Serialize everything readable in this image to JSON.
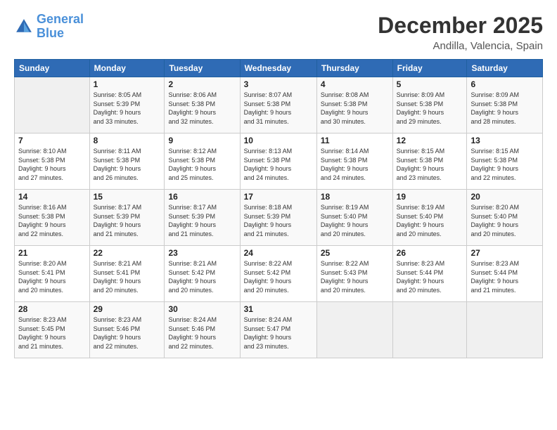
{
  "header": {
    "logo_line1": "General",
    "logo_line2": "Blue",
    "month": "December 2025",
    "location": "Andilla, Valencia, Spain"
  },
  "weekdays": [
    "Sunday",
    "Monday",
    "Tuesday",
    "Wednesday",
    "Thursday",
    "Friday",
    "Saturday"
  ],
  "weeks": [
    [
      {
        "day": "",
        "info": ""
      },
      {
        "day": "1",
        "info": "Sunrise: 8:05 AM\nSunset: 5:39 PM\nDaylight: 9 hours\nand 33 minutes."
      },
      {
        "day": "2",
        "info": "Sunrise: 8:06 AM\nSunset: 5:38 PM\nDaylight: 9 hours\nand 32 minutes."
      },
      {
        "day": "3",
        "info": "Sunrise: 8:07 AM\nSunset: 5:38 PM\nDaylight: 9 hours\nand 31 minutes."
      },
      {
        "day": "4",
        "info": "Sunrise: 8:08 AM\nSunset: 5:38 PM\nDaylight: 9 hours\nand 30 minutes."
      },
      {
        "day": "5",
        "info": "Sunrise: 8:09 AM\nSunset: 5:38 PM\nDaylight: 9 hours\nand 29 minutes."
      },
      {
        "day": "6",
        "info": "Sunrise: 8:09 AM\nSunset: 5:38 PM\nDaylight: 9 hours\nand 28 minutes."
      }
    ],
    [
      {
        "day": "7",
        "info": "Sunrise: 8:10 AM\nSunset: 5:38 PM\nDaylight: 9 hours\nand 27 minutes."
      },
      {
        "day": "8",
        "info": "Sunrise: 8:11 AM\nSunset: 5:38 PM\nDaylight: 9 hours\nand 26 minutes."
      },
      {
        "day": "9",
        "info": "Sunrise: 8:12 AM\nSunset: 5:38 PM\nDaylight: 9 hours\nand 25 minutes."
      },
      {
        "day": "10",
        "info": "Sunrise: 8:13 AM\nSunset: 5:38 PM\nDaylight: 9 hours\nand 24 minutes."
      },
      {
        "day": "11",
        "info": "Sunrise: 8:14 AM\nSunset: 5:38 PM\nDaylight: 9 hours\nand 24 minutes."
      },
      {
        "day": "12",
        "info": "Sunrise: 8:15 AM\nSunset: 5:38 PM\nDaylight: 9 hours\nand 23 minutes."
      },
      {
        "day": "13",
        "info": "Sunrise: 8:15 AM\nSunset: 5:38 PM\nDaylight: 9 hours\nand 22 minutes."
      }
    ],
    [
      {
        "day": "14",
        "info": "Sunrise: 8:16 AM\nSunset: 5:38 PM\nDaylight: 9 hours\nand 22 minutes."
      },
      {
        "day": "15",
        "info": "Sunrise: 8:17 AM\nSunset: 5:39 PM\nDaylight: 9 hours\nand 21 minutes."
      },
      {
        "day": "16",
        "info": "Sunrise: 8:17 AM\nSunset: 5:39 PM\nDaylight: 9 hours\nand 21 minutes."
      },
      {
        "day": "17",
        "info": "Sunrise: 8:18 AM\nSunset: 5:39 PM\nDaylight: 9 hours\nand 21 minutes."
      },
      {
        "day": "18",
        "info": "Sunrise: 8:19 AM\nSunset: 5:40 PM\nDaylight: 9 hours\nand 20 minutes."
      },
      {
        "day": "19",
        "info": "Sunrise: 8:19 AM\nSunset: 5:40 PM\nDaylight: 9 hours\nand 20 minutes."
      },
      {
        "day": "20",
        "info": "Sunrise: 8:20 AM\nSunset: 5:40 PM\nDaylight: 9 hours\nand 20 minutes."
      }
    ],
    [
      {
        "day": "21",
        "info": "Sunrise: 8:20 AM\nSunset: 5:41 PM\nDaylight: 9 hours\nand 20 minutes."
      },
      {
        "day": "22",
        "info": "Sunrise: 8:21 AM\nSunset: 5:41 PM\nDaylight: 9 hours\nand 20 minutes."
      },
      {
        "day": "23",
        "info": "Sunrise: 8:21 AM\nSunset: 5:42 PM\nDaylight: 9 hours\nand 20 minutes."
      },
      {
        "day": "24",
        "info": "Sunrise: 8:22 AM\nSunset: 5:42 PM\nDaylight: 9 hours\nand 20 minutes."
      },
      {
        "day": "25",
        "info": "Sunrise: 8:22 AM\nSunset: 5:43 PM\nDaylight: 9 hours\nand 20 minutes."
      },
      {
        "day": "26",
        "info": "Sunrise: 8:23 AM\nSunset: 5:44 PM\nDaylight: 9 hours\nand 20 minutes."
      },
      {
        "day": "27",
        "info": "Sunrise: 8:23 AM\nSunset: 5:44 PM\nDaylight: 9 hours\nand 21 minutes."
      }
    ],
    [
      {
        "day": "28",
        "info": "Sunrise: 8:23 AM\nSunset: 5:45 PM\nDaylight: 9 hours\nand 21 minutes."
      },
      {
        "day": "29",
        "info": "Sunrise: 8:23 AM\nSunset: 5:46 PM\nDaylight: 9 hours\nand 22 minutes."
      },
      {
        "day": "30",
        "info": "Sunrise: 8:24 AM\nSunset: 5:46 PM\nDaylight: 9 hours\nand 22 minutes."
      },
      {
        "day": "31",
        "info": "Sunrise: 8:24 AM\nSunset: 5:47 PM\nDaylight: 9 hours\nand 23 minutes."
      },
      {
        "day": "",
        "info": ""
      },
      {
        "day": "",
        "info": ""
      },
      {
        "day": "",
        "info": ""
      }
    ]
  ]
}
